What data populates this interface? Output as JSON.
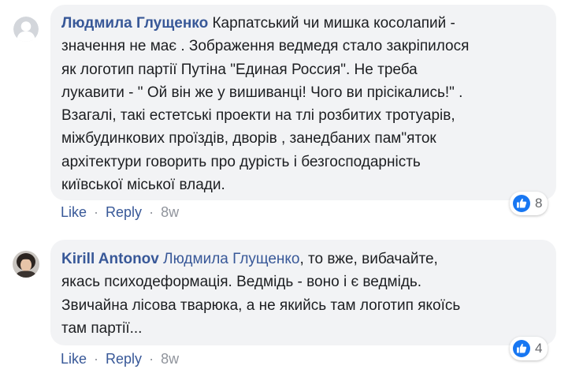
{
  "comments": [
    {
      "author": "Людмила Глущенко",
      "avatar_icon": "default-avatar-icon",
      "text_lines": [
        "Карпатський чи мишка косолапий -",
        "значення не має . Зображення ведмедя стало закріпилося",
        "як логотип партії Путіна \"Единая Россия\". Не треба",
        "лукавити - \" Ой він же у вишиванці! Чого ви прісікались!\" .",
        "Взагалі, такі естетські проекти на тлі розбитих тротуарів,",
        "міжбудинкових проїздів, дворів , занедбаних пам\"яток",
        "архітектури говорить про дурість і безгосподарність",
        "київської міської влади."
      ],
      "reaction_icon": "like-icon",
      "reaction_count": "8",
      "actions": {
        "like": "Like",
        "sep1": "·",
        "reply": "Reply",
        "sep2": "·",
        "time": "8w"
      }
    },
    {
      "author": "Kirill Antonov",
      "avatar_icon": "user-photo-avatar",
      "mention": "Людмила Глущенко",
      "first_line_rest": ", то вже, вибачайте,",
      "text_lines": [
        "якась психодеформація. Ведмідь - воно і є ведмідь.",
        "Звичайна лісова тварюка, а не якийсь там логотип якоїсь",
        "там партії..."
      ],
      "reaction_icon": "like-icon",
      "reaction_count": "4",
      "actions": {
        "like": "Like",
        "sep1": "·",
        "reply": "Reply",
        "sep2": "·",
        "time": "8w"
      }
    }
  ],
  "colors": {
    "bubble": "#f2f3f5",
    "author": "#385898",
    "link": "#385898",
    "meta": "#90949c",
    "like_blue": "#1877f2"
  }
}
